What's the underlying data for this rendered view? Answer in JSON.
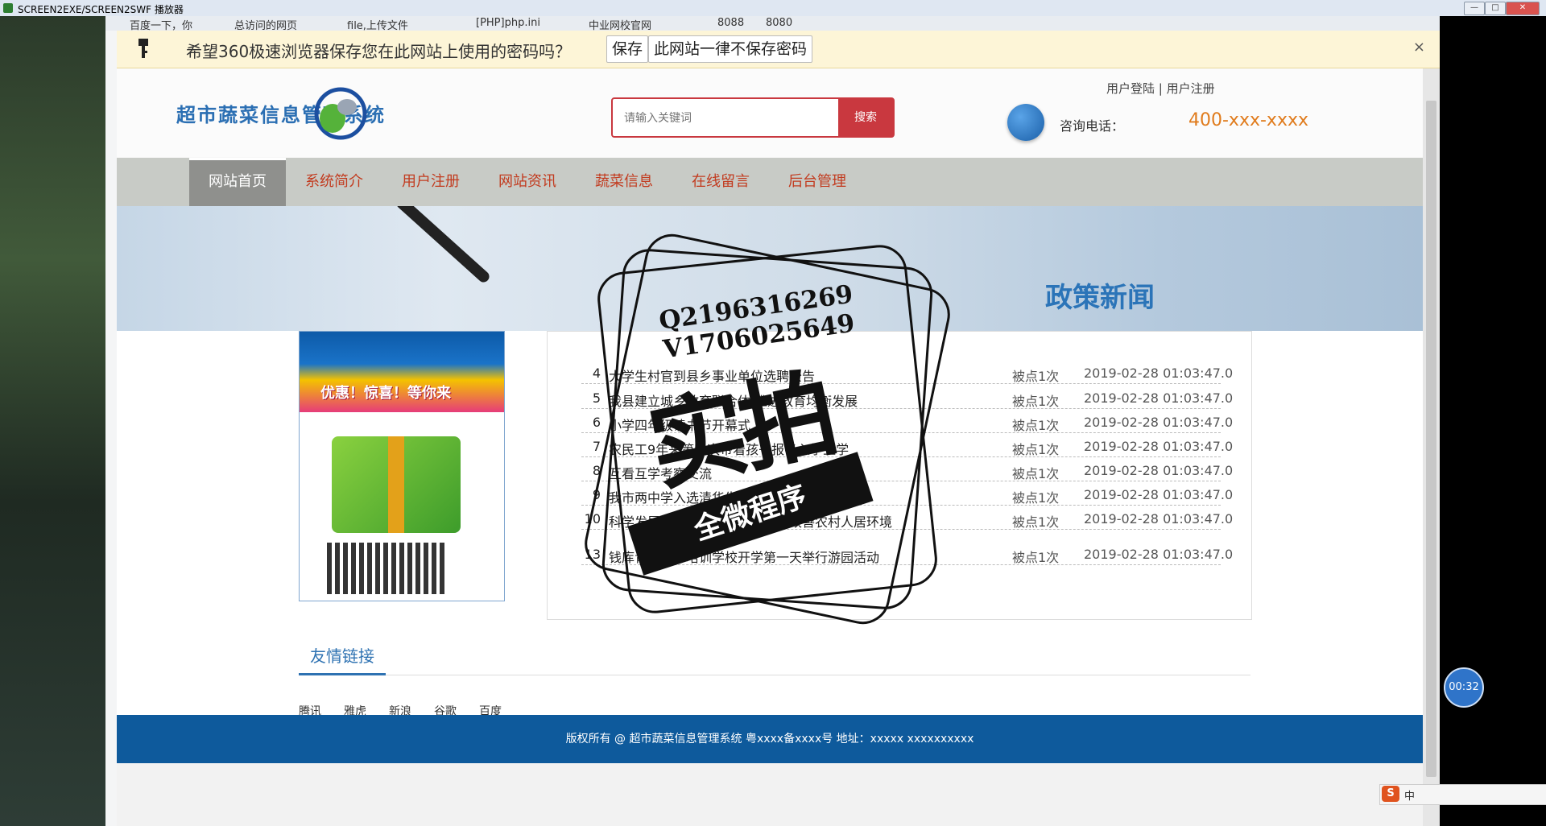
{
  "player": {
    "title": "SCREEN2EXE/SCREEN2SWF 播放器",
    "timer": "00:32"
  },
  "bookmarks": [
    "百度一下，你",
    "总访问的网页",
    "file,上传文件",
    "[PHP]php.ini",
    "中业网校官网",
    "8088",
    "8080"
  ],
  "password_bar": {
    "message": "希望360极速浏览器保存您在此网站上使用的密码吗？",
    "save": "保存",
    "never": "此网站一律不保存密码",
    "close": "×"
  },
  "header": {
    "logo_text": "超市蔬菜信息管理系统",
    "search_placeholder": "请输入关键词",
    "search_button": "搜索",
    "login": "用户登陆",
    "separator": "|",
    "register": "用户注册",
    "phone_label": "咨询电话：",
    "phone_number": "400-xxx-xxxx"
  },
  "nav": [
    {
      "label": "网站首页",
      "active": true
    },
    {
      "label": "系统简介",
      "active": false
    },
    {
      "label": "用户注册",
      "active": false
    },
    {
      "label": "网站资讯",
      "active": false
    },
    {
      "label": "蔬菜信息",
      "active": false
    },
    {
      "label": "在线留言",
      "active": false
    },
    {
      "label": "后台管理",
      "active": false
    }
  ],
  "banner": {
    "title": "政策新闻"
  },
  "ad": {
    "slogan": "优惠！惊喜！等你来"
  },
  "news": [
    {
      "n": "4",
      "title": "大学生村官到县乡事业单位选聘公告",
      "hits": "被点1次",
      "date": "2019-02-28 01:03:47.0"
    },
    {
      "n": "5",
      "title": "我县建立城乡教育联合体 推进教育均衡发展",
      "hits": "被点1次",
      "date": "2019-02-28 01:03:47.0"
    },
    {
      "n": "6",
      "title": "小学四年级读书节开幕式",
      "hits": "被点1次",
      "date": "2019-02-28 01:03:47.0"
    },
    {
      "n": "7",
      "title": "农民工9年来第一次带着孩子报名入学上学",
      "hits": "被点1次",
      "date": "2019-02-28 01:03:47.0"
    },
    {
      "n": "8",
      "title": "互看互学考察交流",
      "hits": "被点1次",
      "date": "2019-02-28 01:03:47.0"
    },
    {
      "n": "9",
      "title": "我市两中学入选清华生源基地",
      "hits": "被点1次",
      "date": "2019-02-28 01:03:47.0"
    },
    {
      "n": "10",
      "title": "科学发展在钱库重点区域建设，改善农村人居环境",
      "hits": "被点1次",
      "date": "2019-02-28 01:03:47.0"
    },
    {
      "n": "13",
      "title": "钱库青春艺术培训学校开学第一天举行游园活动",
      "hits": "被点1次",
      "date": "2019-02-28 01:03:47.0"
    }
  ],
  "friend_links": {
    "title": "友情链接",
    "items": [
      "腾讯",
      "雅虎",
      "新浪",
      "谷歌",
      "百度"
    ]
  },
  "footer": {
    "text": "版权所有 @ 超市蔬菜信息管理系统 粤xxxx备xxxx号 地址：xxxxx xxxxxxxxxx"
  },
  "watermark": {
    "qq": "Q2196316269",
    "vx": "V1706025649",
    "big": "实拍",
    "banner": "全微程序"
  },
  "ime": {
    "logo": "S",
    "lang": "中"
  }
}
